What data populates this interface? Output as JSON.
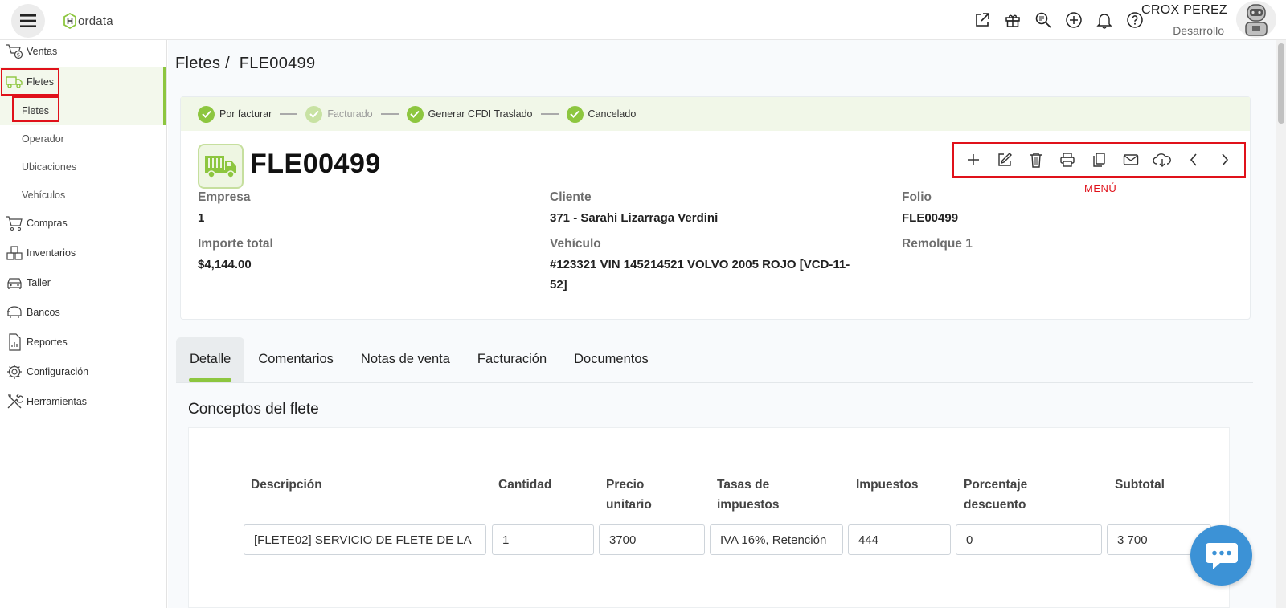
{
  "app": {
    "logo_text": "ordata"
  },
  "header": {
    "user_name": "CROX PEREZ",
    "user_role": "Desarrollo",
    "icons": [
      "external-link-icon",
      "gift-icon",
      "search-zoom-icon",
      "plus-circle-icon",
      "bell-icon",
      "help-icon"
    ]
  },
  "sidebar": {
    "items": [
      {
        "label": "Ventas",
        "icon": "sales-icon"
      },
      {
        "label": "Fletes",
        "icon": "truck-icon"
      },
      {
        "label": "Fletes",
        "icon": null
      },
      {
        "label": "Operador",
        "icon": null
      },
      {
        "label": "Ubicaciones",
        "icon": null
      },
      {
        "label": "Vehículos",
        "icon": null
      },
      {
        "label": "Compras",
        "icon": "cart-icon"
      },
      {
        "label": "Inventarios",
        "icon": "boxes-icon"
      },
      {
        "label": "Taller",
        "icon": "car-icon"
      },
      {
        "label": "Bancos",
        "icon": "bank-icon"
      },
      {
        "label": "Reportes",
        "icon": "report-icon"
      },
      {
        "label": "Configuración",
        "icon": "gear-icon"
      },
      {
        "label": "Herramientas",
        "icon": "tools-icon"
      }
    ]
  },
  "breadcrumb": {
    "parent": "Fletes /",
    "current": "FLE00499"
  },
  "status_steps": [
    {
      "label": "Por facturar",
      "done": true
    },
    {
      "label": "Facturado",
      "done": false
    },
    {
      "label": "Generar CFDI Traslado",
      "done": true
    },
    {
      "label": "Cancelado",
      "done": true
    }
  ],
  "record": {
    "folio": "FLE00499",
    "fields": {
      "empresa_label": "Empresa",
      "empresa": "1",
      "cliente_label": "Cliente",
      "cliente": "371 - Sarahi Lizarraga Verdini",
      "folio_label": "Folio",
      "folio": "FLE00499",
      "importe_label": "Importe total",
      "importe": "$4,144.00",
      "vehiculo_label": "Vehículo",
      "vehiculo_line1": "#123321 VIN 145214521 VOLVO 2005 ROJO [VCD-11-",
      "vehiculo_line2": "52]",
      "remolque_label": "Remolque 1"
    }
  },
  "toolbar": {
    "icons": [
      "add-icon",
      "edit-icon",
      "delete-icon",
      "print-icon",
      "copy-icon",
      "email-icon",
      "cloud-download-icon",
      "prev-icon",
      "next-icon"
    ],
    "annotation": "MENÚ"
  },
  "tabs": [
    "Detalle",
    "Comentarios",
    "Notas de venta",
    "Facturación",
    "Documentos"
  ],
  "section": {
    "title": "Conceptos del flete"
  },
  "table": {
    "headers": [
      {
        "l1": "Descripción",
        "l2": ""
      },
      {
        "l1": "Cantidad",
        "l2": ""
      },
      {
        "l1": "Precio",
        "l2": "unitario"
      },
      {
        "l1": "Tasas de",
        "l2": "impuestos"
      },
      {
        "l1": "Impuestos",
        "l2": ""
      },
      {
        "l1": "Porcentaje",
        "l2": "descuento"
      },
      {
        "l1": "Subtotal",
        "l2": ""
      }
    ],
    "rows": [
      [
        "[FLETE02] SERVICIO DE FLETE DE LA",
        "1",
        "3700",
        "IVA 16%, Retención",
        "444",
        "0",
        "3 700"
      ]
    ]
  },
  "colors": {
    "accent": "#8dc63f",
    "annotation": "#e0111a",
    "chat": "#3c92d6"
  }
}
